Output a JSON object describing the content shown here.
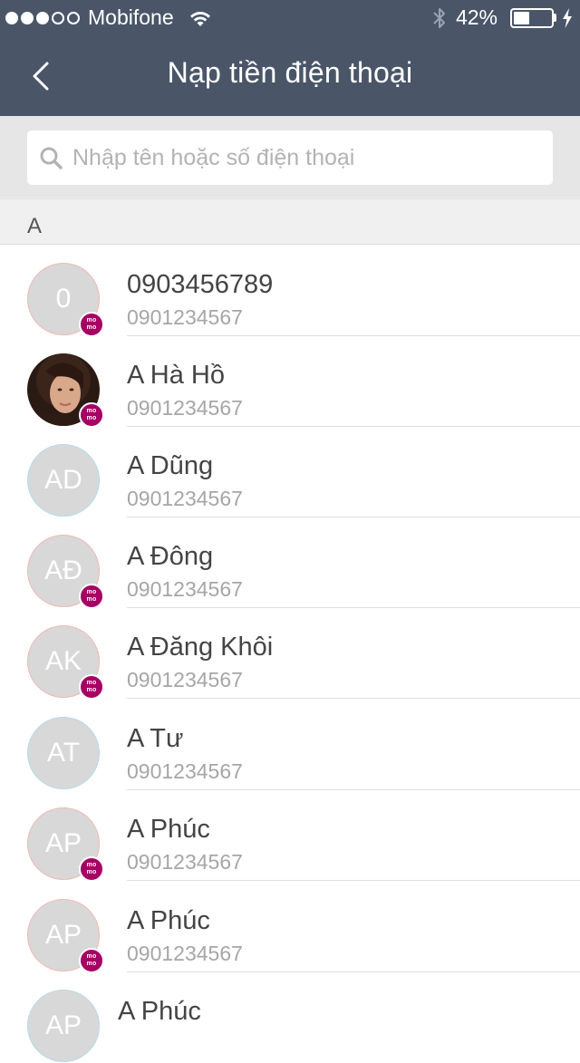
{
  "status_bar": {
    "carrier": "Mobifone",
    "signal_filled": 3,
    "signal_total": 5,
    "battery_percent": "42%",
    "battery_level": 0.42
  },
  "nav": {
    "title": "Nạp tiền điện thoại",
    "back_icon": "chevron-left-icon"
  },
  "search": {
    "placeholder": "Nhập tên hoặc số điện thoại",
    "icon": "search-icon"
  },
  "section": {
    "letter": "A"
  },
  "contacts": [
    {
      "name": "0903456789",
      "phone": "0901234567",
      "initials": "0",
      "ring": "red",
      "momo": true,
      "photo": false
    },
    {
      "name": "A Hà Hồ",
      "phone": "0901234567",
      "initials": "",
      "ring": "none",
      "momo": true,
      "photo": true
    },
    {
      "name": "A Dũng",
      "phone": "0901234567",
      "initials": "AD",
      "ring": "blue",
      "momo": false,
      "photo": false
    },
    {
      "name": "A Đông",
      "phone": "0901234567",
      "initials": "AĐ",
      "ring": "red",
      "momo": true,
      "photo": false
    },
    {
      "name": "A Đăng Khôi",
      "phone": "0901234567",
      "initials": "AK",
      "ring": "red",
      "momo": true,
      "photo": false
    },
    {
      "name": "A Tư",
      "phone": "0901234567",
      "initials": "AT",
      "ring": "blue",
      "momo": false,
      "photo": false
    },
    {
      "name": "A Phúc",
      "phone": "0901234567",
      "initials": "AP",
      "ring": "red",
      "momo": true,
      "photo": false
    },
    {
      "name": "A Phúc",
      "phone": "0901234567",
      "initials": "AP",
      "ring": "red",
      "momo": true,
      "photo": false
    },
    {
      "name": "A Phúc",
      "phone": "",
      "initials": "AP",
      "ring": "blue",
      "momo": false,
      "photo": false
    }
  ],
  "badge": {
    "text_top": "mo",
    "text_bottom": "mo",
    "color": "#a50064"
  },
  "colors": {
    "header_bg": "#4a5668",
    "search_bg": "#e6e6e6",
    "avatar_bg": "#d8d8d8",
    "momo": "#a50064"
  }
}
